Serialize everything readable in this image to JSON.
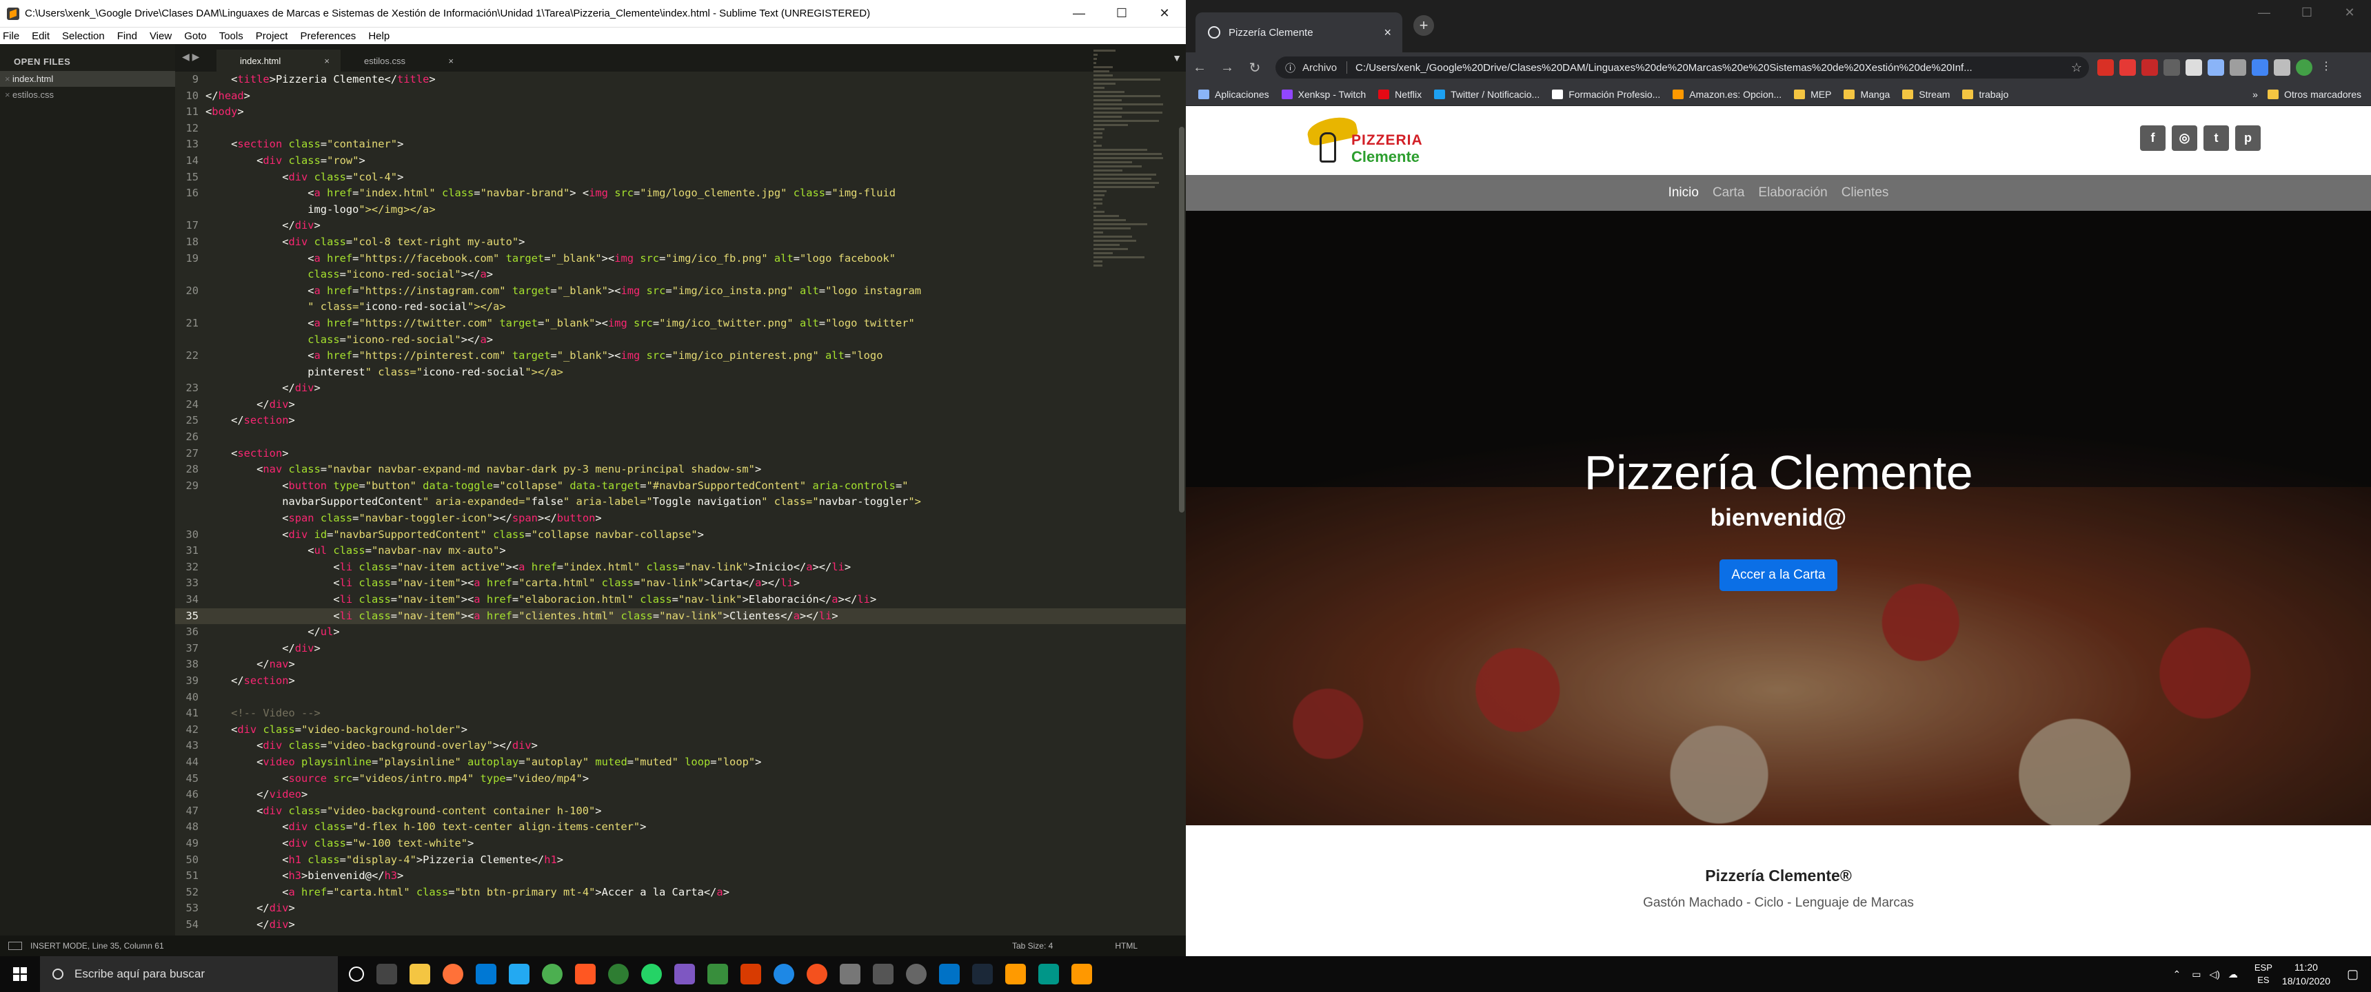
{
  "sublime": {
    "title": "C:\\Users\\xenk_\\Google Drive\\Clases DAM\\Linguaxes de Marcas e Sistemas de Xestión de Información\\Unidad 1\\Tarea\\Pizzeria_Clemente\\index.html - Sublime Text (UNREGISTERED)",
    "menu": [
      "File",
      "Edit",
      "Selection",
      "Find",
      "View",
      "Goto",
      "Tools",
      "Project",
      "Preferences",
      "Help"
    ],
    "sidebar_header": "OPEN FILES",
    "files": [
      "index.html",
      "estilos.css"
    ],
    "tabs": [
      "index.html",
      "estilos.css"
    ],
    "status_left": "INSERT MODE, Line 35, Column 61",
    "status_tab": "Tab Size: 4",
    "status_syntax": "HTML",
    "code_lines": [
      {
        "n": "9",
        "t": "    <title>Pizzeria Clemente</title>"
      },
      {
        "n": "10",
        "t": "</head>"
      },
      {
        "n": "11",
        "t": "<body>"
      },
      {
        "n": "12",
        "t": ""
      },
      {
        "n": "13",
        "t": "    <section class=\"container\">"
      },
      {
        "n": "14",
        "t": "        <div class=\"row\">"
      },
      {
        "n": "15",
        "t": "            <div class=\"col-4\">"
      },
      {
        "n": "16",
        "t": "                <a href=\"index.html\" class=\"navbar-brand\"> <img src=\"img/logo_clemente.jpg\" class=\"img-fluid"
      },
      {
        "n": "",
        "t": "                img-logo\"></img></a>"
      },
      {
        "n": "17",
        "t": "            </div>"
      },
      {
        "n": "18",
        "t": "            <div class=\"col-8 text-right my-auto\">"
      },
      {
        "n": "19",
        "t": "                <a href=\"https://facebook.com\" target=\"_blank\"><img src=\"img/ico_fb.png\" alt=\"logo facebook\""
      },
      {
        "n": "",
        "t": "                class=\"icono-red-social\"></a>"
      },
      {
        "n": "20",
        "t": "                <a href=\"https://instagram.com\" target=\"_blank\"><img src=\"img/ico_insta.png\" alt=\"logo instagram"
      },
      {
        "n": "",
        "t": "                \" class=\"icono-red-social\"></a>"
      },
      {
        "n": "21",
        "t": "                <a href=\"https://twitter.com\" target=\"_blank\"><img src=\"img/ico_twitter.png\" alt=\"logo twitter\""
      },
      {
        "n": "",
        "t": "                class=\"icono-red-social\"></a>"
      },
      {
        "n": "22",
        "t": "                <a href=\"https://pinterest.com\" target=\"_blank\"><img src=\"img/ico_pinterest.png\" alt=\"logo"
      },
      {
        "n": "",
        "t": "                pinterest\" class=\"icono-red-social\"></a>"
      },
      {
        "n": "23",
        "t": "            </div>"
      },
      {
        "n": "24",
        "t": "        </div>"
      },
      {
        "n": "25",
        "t": "    </section>"
      },
      {
        "n": "26",
        "t": ""
      },
      {
        "n": "27",
        "t": "    <section>"
      },
      {
        "n": "28",
        "t": "        <nav class=\"navbar navbar-expand-md navbar-dark py-3 menu-principal shadow-sm\">"
      },
      {
        "n": "29",
        "t": "            <button type=\"button\" data-toggle=\"collapse\" data-target=\"#navbarSupportedContent\" aria-controls=\""
      },
      {
        "n": "",
        "t": "            navbarSupportedContent\" aria-expanded=\"false\" aria-label=\"Toggle navigation\" class=\"navbar-toggler\">"
      },
      {
        "n": "",
        "t": "            <span class=\"navbar-toggler-icon\"></span></button>"
      },
      {
        "n": "30",
        "t": "            <div id=\"navbarSupportedContent\" class=\"collapse navbar-collapse\">"
      },
      {
        "n": "31",
        "t": "                <ul class=\"navbar-nav mx-auto\">"
      },
      {
        "n": "32",
        "t": "                    <li class=\"nav-item active\"><a href=\"index.html\" class=\"nav-link\">Inicio</a></li>"
      },
      {
        "n": "33",
        "t": "                    <li class=\"nav-item\"><a href=\"carta.html\" class=\"nav-link\">Carta</a></li>"
      },
      {
        "n": "34",
        "t": "                    <li class=\"nav-item\"><a href=\"elaboracion.html\" class=\"nav-link\">Elaboración</a></li>"
      },
      {
        "n": "35",
        "t": "                    <li class=\"nav-item\"><a href=\"clientes.html\" class=\"nav-link\">Clientes</a></li>"
      },
      {
        "n": "36",
        "t": "                </ul>"
      },
      {
        "n": "37",
        "t": "            </div>"
      },
      {
        "n": "38",
        "t": "        </nav>"
      },
      {
        "n": "39",
        "t": "    </section>"
      },
      {
        "n": "40",
        "t": ""
      },
      {
        "n": "41",
        "t": "    <!-- Video -->"
      },
      {
        "n": "42",
        "t": "    <div class=\"video-background-holder\">"
      },
      {
        "n": "43",
        "t": "        <div class=\"video-background-overlay\"></div>"
      },
      {
        "n": "44",
        "t": "        <video playsinline=\"playsinline\" autoplay=\"autoplay\" muted=\"muted\" loop=\"loop\">"
      },
      {
        "n": "45",
        "t": "            <source src=\"videos/intro.mp4\" type=\"video/mp4\">"
      },
      {
        "n": "46",
        "t": "        </video>"
      },
      {
        "n": "47",
        "t": "        <div class=\"video-background-content container h-100\">"
      },
      {
        "n": "48",
        "t": "            <div class=\"d-flex h-100 text-center align-items-center\">"
      },
      {
        "n": "49",
        "t": "            <div class=\"w-100 text-white\">"
      },
      {
        "n": "50",
        "t": "            <h1 class=\"display-4\">Pizzeria Clemente</h1>"
      },
      {
        "n": "51",
        "t": "            <h3>bienvenid@</h3>"
      },
      {
        "n": "52",
        "t": "            <a href=\"carta.html\" class=\"btn btn-primary mt-4\">Accer a la Carta</a>"
      },
      {
        "n": "53",
        "t": "        </div>"
      },
      {
        "n": "54",
        "t": "        </div>"
      }
    ]
  },
  "chrome": {
    "tab_title": "Pizzería Clemente",
    "address_label": "Archivo",
    "url": "C:/Users/xenk_/Google%20Drive/Clases%20DAM/Linguaxes%20de%20Marcas%20e%20Sistemas%20de%20Xestión%20de%20Inf...",
    "bookmarks": [
      "Aplicaciones",
      "Xenksp - Twitch",
      "Netflix",
      "Twitter / Notificacio...",
      "Formación Profesio...",
      "Amazon.es: Opcion...",
      "MEP",
      "Manga",
      "Stream",
      "trabajo"
    ],
    "bookmarks_more": "»",
    "other_bookmarks": "Otros marcadores"
  },
  "site": {
    "logo_word1": "PIZZERIA",
    "logo_word2": "Clemente",
    "social": [
      "f",
      "◎",
      "t",
      "p"
    ],
    "nav": [
      "Inicio",
      "Carta",
      "Elaboración",
      "Clientes"
    ],
    "hero_title": "Pizzería Clemente",
    "hero_subtitle": "bienvenid@",
    "hero_button": "Accer a la Carta",
    "footer_title": "Pizzería Clemente®",
    "footer_sub": "Gastón Machado - Ciclo - Lenguaje de Marcas"
  },
  "taskbar": {
    "search_placeholder": "Escribe aquí para buscar",
    "lang1": "ESP",
    "lang2": "ES",
    "time": "11:20",
    "date": "18/10/2020"
  },
  "colors": {
    "sublime_bg": "#272822",
    "accent_button": "#0b6fe6",
    "navbar_bg": "#6f6f6f",
    "logo_red": "#d21f26",
    "logo_green": "#2c9e2e"
  }
}
